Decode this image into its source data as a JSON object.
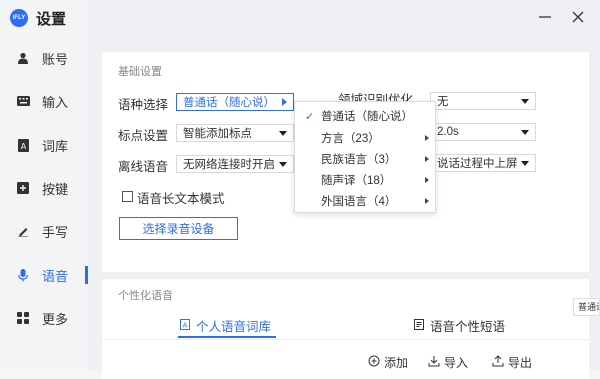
{
  "app": {
    "logo_text": "iFLY",
    "title": "设置"
  },
  "sidebar": {
    "items": [
      {
        "label": "账号",
        "icon": "user-icon"
      },
      {
        "label": "输入",
        "icon": "keyboard-icon"
      },
      {
        "label": "词库",
        "icon": "book-icon"
      },
      {
        "label": "按键",
        "icon": "key-icon"
      },
      {
        "label": "手写",
        "icon": "pen-icon"
      },
      {
        "label": "语音",
        "icon": "mic-icon",
        "active": true
      },
      {
        "label": "更多",
        "icon": "grid-icon"
      }
    ]
  },
  "basic": {
    "title": "基础设置",
    "lang_label": "语种选择",
    "lang_value": "普通话（随心说）",
    "punct_label": "标点设置",
    "punct_value": "智能添加标点",
    "offline_label": "离线语音",
    "offline_value": "无网络连接时开启",
    "field_opt_label": "领域识别优化",
    "field_opt_value": "无",
    "pause_value": "2.0s",
    "display_value": "说话过程中上屏",
    "longtext_label": "语音长文本模式",
    "select_device_label": "选择录音设备"
  },
  "lang_menu": {
    "items": [
      {
        "label": "普通话（随心说）",
        "checked": true,
        "submenu": false
      },
      {
        "label": "方言（23）",
        "checked": false,
        "submenu": true
      },
      {
        "label": "民族语言（3）",
        "checked": false,
        "submenu": true
      },
      {
        "label": "随声译（18）",
        "checked": false,
        "submenu": true
      },
      {
        "label": "外国语言（4）",
        "checked": false,
        "submenu": true
      }
    ]
  },
  "personal": {
    "title": "个性化语音",
    "tab_lexicon": "个人语音词库",
    "tab_phrases": "语音个性短语",
    "add_label": "添加",
    "import_label": "导入",
    "export_label": "导出"
  },
  "tooltip": {
    "text": "普通话"
  },
  "colors": {
    "accent": "#2d6cf6",
    "sidebar_bg": "#f3f4f6",
    "content_bg": "#eef0f3"
  }
}
